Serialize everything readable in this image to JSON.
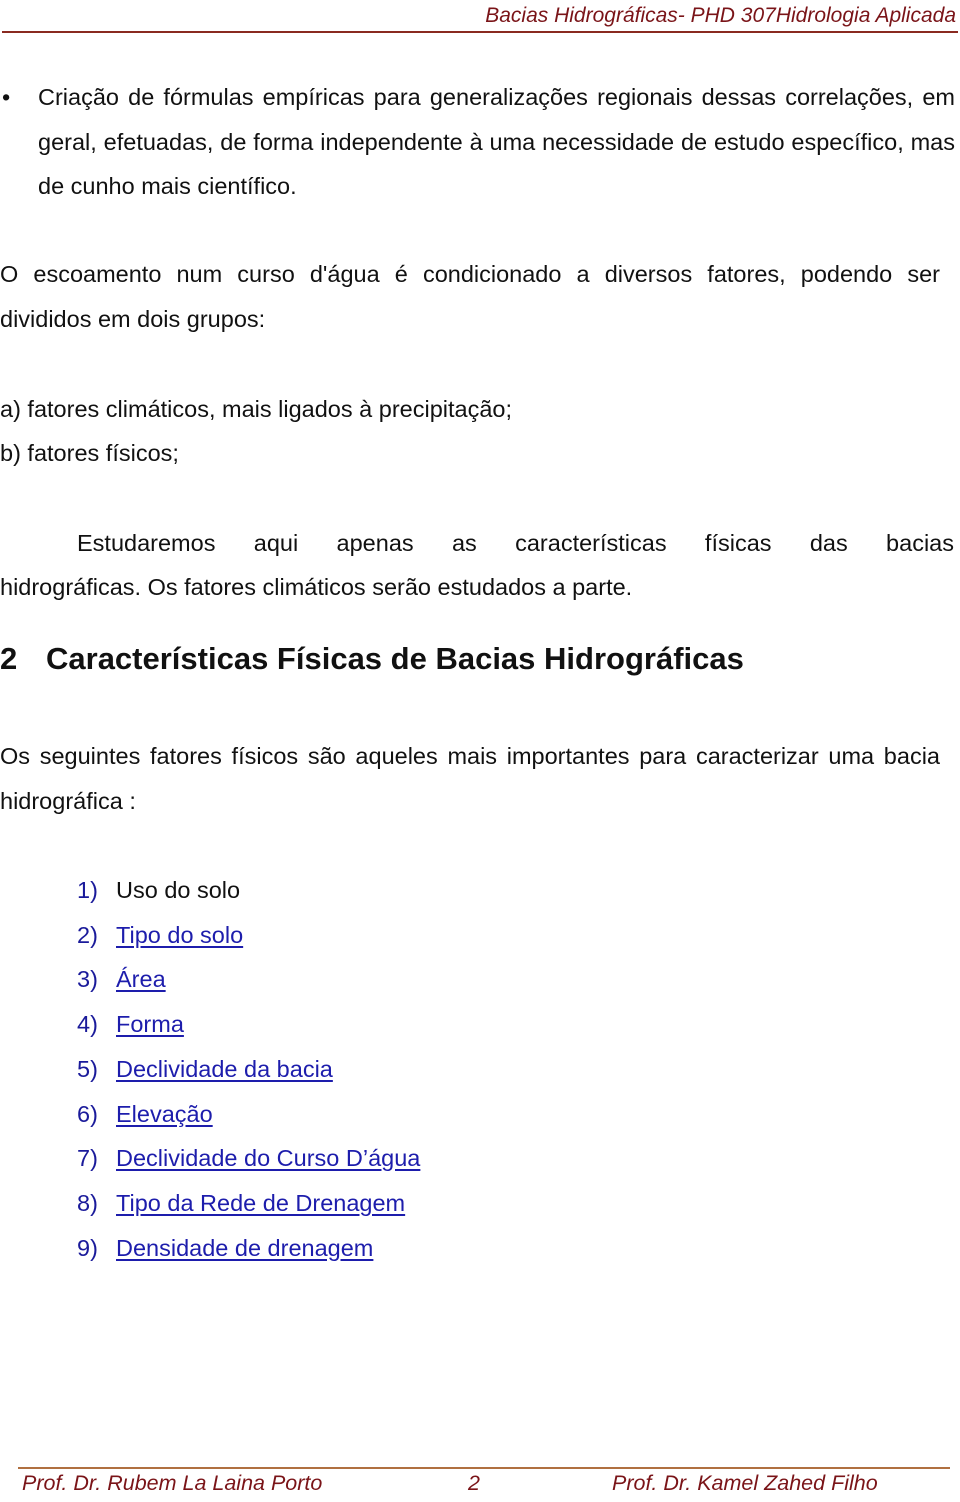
{
  "header": {
    "title": "Bacias Hidrográficas- PHD 307Hidrologia Aplicada"
  },
  "bullet": {
    "symbol": "•",
    "text": "Criação de fórmulas empíricas para generalizações regionais dessas correlações, em geral, efetuadas, de forma independente à uma necessidade de estudo específico, mas de cunho mais científico."
  },
  "paragraphs": {
    "escoamento": "O escoamento num curso d'água é condicionado a diversos fatores, podendo ser divididos em dois grupos:",
    "factor_a": "a) fatores climáticos, mais ligados à precipitação;",
    "factor_b": "b) fatores físicos;",
    "estudaremos_line1": "Estudaremos aqui apenas as características físicas das bacias",
    "estudaremos_line2": "hidrográficas. Os fatores climáticos serão estudados a parte.",
    "seguintes": "Os seguintes fatores físicos são aqueles mais importantes para caracterizar uma bacia hidrográfica :"
  },
  "section": {
    "number": "2",
    "title": "Características Físicas de Bacias Hidrográficas"
  },
  "factors_list": [
    {
      "num": "1)",
      "label": "Uso do solo",
      "link": false
    },
    {
      "num": "2)",
      "label": "Tipo do solo",
      "link": true
    },
    {
      "num": "3)",
      "label": "Área",
      "link": true
    },
    {
      "num": "4)",
      "label": "Forma",
      "link": true
    },
    {
      "num": "5)",
      "label": "Declividade da bacia",
      "link": true
    },
    {
      "num": "6)",
      "label": "Elevação",
      "link": true
    },
    {
      "num": "7)",
      "label": "Declividade do Curso D’água",
      "link": true
    },
    {
      "num": "8)",
      "label": "Tipo da Rede de Drenagem",
      "link": true
    },
    {
      "num": "9)",
      "label": "Densidade de drenagem",
      "link": true
    }
  ],
  "footer": {
    "left": "Prof. Dr. Rubem La Laina Porto",
    "page": "2",
    "right": "Prof. Dr. Kamel Zahed Filho"
  },
  "colors": {
    "header_footer": "#7a1418",
    "link": "#1d1dac",
    "text": "#111111"
  }
}
